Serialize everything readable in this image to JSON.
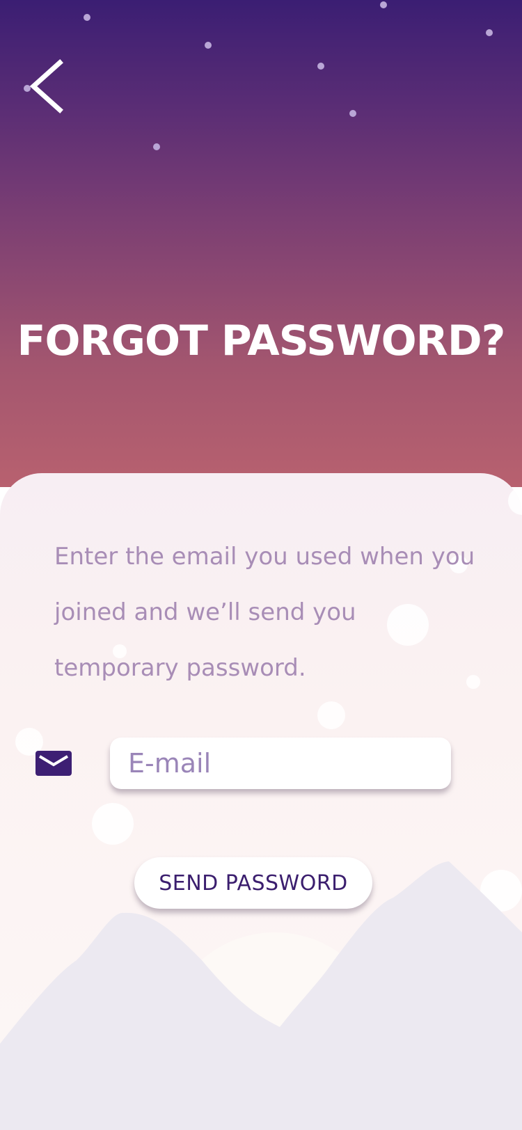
{
  "header": {
    "title": "FORGOT PASSWORD?",
    "back_icon": "chevron-left-icon"
  },
  "form": {
    "instructions": "Enter the email you used when you joined and we’ll send you temporary password.",
    "email_icon": "mail-icon",
    "email_placeholder": "E-mail",
    "email_value": "",
    "submit_label": "SEND PASSWORD"
  },
  "colors": {
    "header_top": "#3b1e73",
    "header_bottom": "#b8616f",
    "accent": "#3b1e6e",
    "body_text": "#a88db6",
    "panel": "#f8f0f3",
    "mountains": "#ece9f1"
  }
}
